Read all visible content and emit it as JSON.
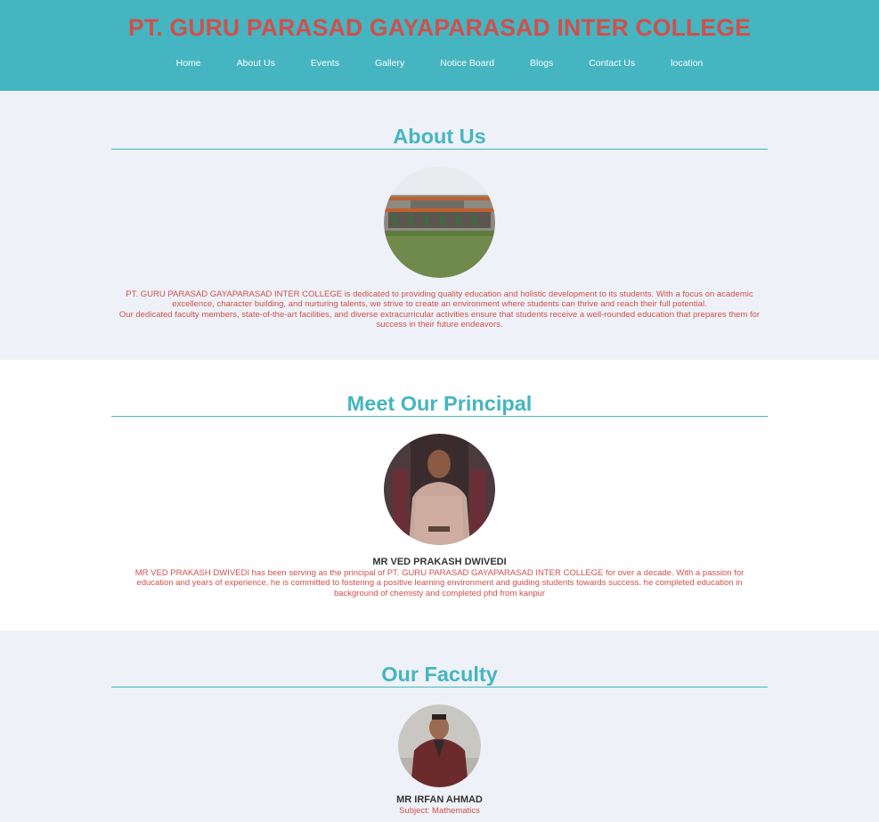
{
  "header": {
    "title": "PT. GURU PARASAD GAYAPARASAD INTER COLLEGE",
    "nav": [
      "Home",
      "About Us",
      "Events",
      "Gallery",
      "Notice Board",
      "Blogs",
      "Contact Us",
      "location"
    ]
  },
  "about": {
    "heading": "About Us",
    "para1": "PT. GURU PARASAD GAYAPARASAD INTER COLLEGE is dedicated to providing quality education and holistic development to its students. With a focus on academic excellence, character building, and nurturing talents, we strive to create an environment where students can thrive and reach their full potential.",
    "para2": "Our dedicated faculty members, state-of-the-art facilities, and diverse extracurricular activities ensure that students receive a well-rounded education that prepares them for success in their future endeavors."
  },
  "principal": {
    "heading": "Meet Our Principal",
    "name": "MR VED PRAKASH DWIVEDI",
    "description": "MR VED PRAKASH DWIVEDI has been serving as the principal of PT. GURU PARASAD GAYAPARASAD INTER COLLEGE for over a decade. With a passion for education and years of experience, he is committed to fostering a positive learning environment and guiding students towards success. he completed education in background of chemisty and completed phd from kanpur"
  },
  "faculty": {
    "heading": "Our Faculty",
    "members": [
      {
        "name": "MR IRFAN AHMAD",
        "subject": "Subject: Mathematics"
      }
    ]
  },
  "colors": {
    "header_bg": "#45b5c1",
    "title_red": "#d24f4b",
    "heading_teal": "#45b5c1",
    "section_alt_bg": "#eef2f8"
  }
}
